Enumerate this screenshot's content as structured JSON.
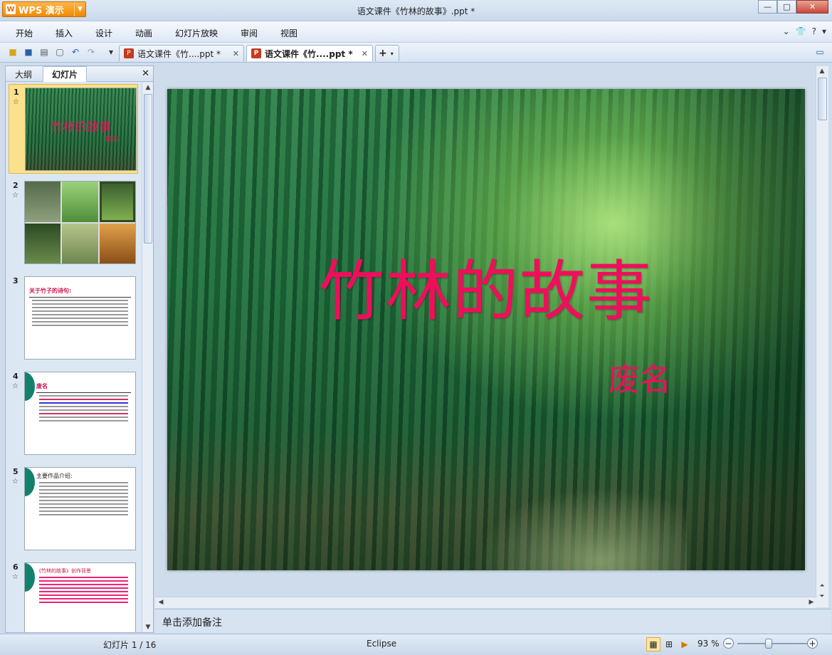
{
  "app": {
    "name": "WPS 演示",
    "window_title": "语文课件《竹林的故事》.ppt *"
  },
  "menu": [
    "开始",
    "插入",
    "设计",
    "动画",
    "幻灯片放映",
    "审阅",
    "视图"
  ],
  "doc_tabs": [
    {
      "label": "语文课件《竹....ppt *",
      "active": false
    },
    {
      "label": "语文课件《竹....ppt *",
      "active": true
    }
  ],
  "panel": {
    "tabs": [
      "大纲",
      "幻灯片"
    ],
    "active_tab": "幻灯片"
  },
  "thumbnails": [
    {
      "num": "1",
      "title": "竹林的故事",
      "sub": "废名"
    },
    {
      "num": "2"
    },
    {
      "num": "3",
      "title": "关于竹子的诗句:"
    },
    {
      "num": "4",
      "title": "废名"
    },
    {
      "num": "5",
      "title": "主要作品介绍:"
    },
    {
      "num": "6",
      "title": "《竹林的故事》创作背景"
    }
  ],
  "slide": {
    "title": "竹林的故事",
    "author": "废名"
  },
  "notes_placeholder": "单击添加备注",
  "status": {
    "slide_indicator": "幻灯片 1 / 16",
    "theme": "Eclipse",
    "zoom": "93 %",
    "zoom_level": 0.45
  },
  "colors": {
    "title": "#ef0e5c",
    "accent": "#f08a00"
  }
}
